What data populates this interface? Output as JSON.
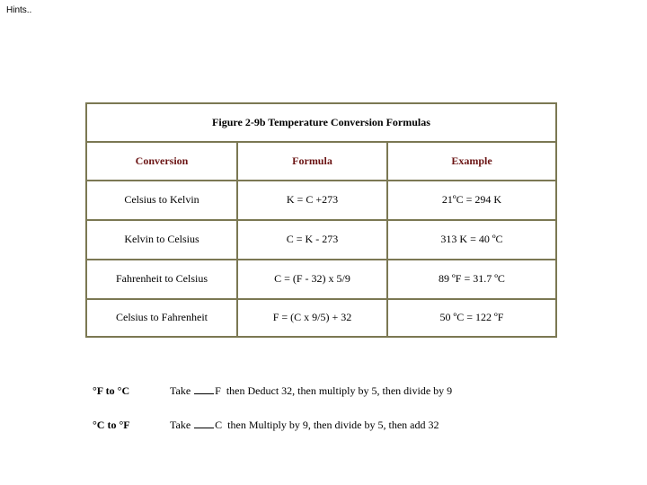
{
  "hint": "Hints..",
  "table": {
    "caption": "Figure 2-9b Temperature Conversion Formulas",
    "headers": [
      "Conversion",
      "Formula",
      "Example"
    ],
    "rows": [
      [
        "Celsius to Kelvin",
        "K = C +273",
        "21ºC = 294 K"
      ],
      [
        "Kelvin to Celsius",
        "C = K - 273",
        "313 K = 40 ºC"
      ],
      [
        "Fahrenheit to Celsius",
        "C = (F - 32) x 5/9",
        "89 ºF = 31.7 ºC"
      ],
      [
        "Celsius to Fahrenheit",
        "F = (C x 9/5) + 32",
        "50 ºC = 122 ºF"
      ]
    ]
  },
  "rules": [
    {
      "label": "°F to °C",
      "prefix": "Take",
      "unit": "F",
      "text": "then Deduct 32, then multiply by 5, then divide by 9"
    },
    {
      "label": "°C to °F",
      "prefix": "Take",
      "unit": "C",
      "text": "then Multiply by 9, then divide by 5, then add 32"
    }
  ],
  "colors": {
    "border": "#7b7853",
    "header_text": "#6b1414"
  }
}
